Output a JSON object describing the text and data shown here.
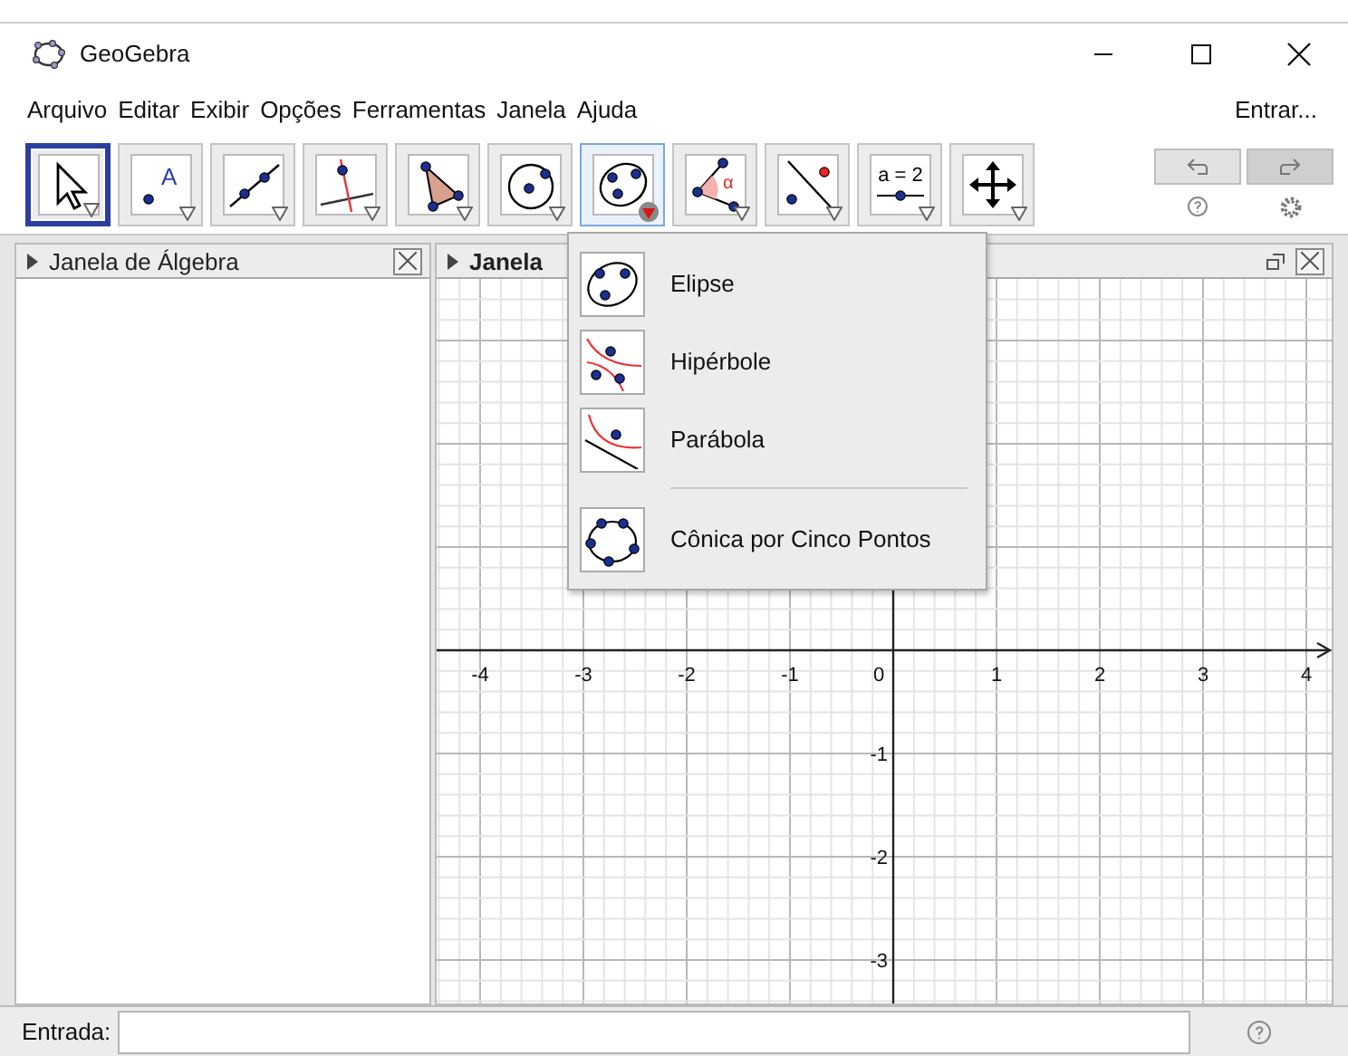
{
  "window": {
    "title": "GeoGebra"
  },
  "menu": [
    "Arquivo",
    "Editar",
    "Exibir",
    "Opções",
    "Ferramentas",
    "Janela",
    "Ajuda"
  ],
  "sign_in": "Entrar...",
  "tools": [
    {
      "kind": "move",
      "selected": true,
      "open": false
    },
    {
      "kind": "point",
      "caption": "A",
      "selected": false,
      "open": false
    },
    {
      "kind": "line",
      "selected": false,
      "open": false
    },
    {
      "kind": "perpendicular",
      "selected": false,
      "open": false
    },
    {
      "kind": "polygon",
      "selected": false,
      "open": false
    },
    {
      "kind": "circle",
      "selected": false,
      "open": false
    },
    {
      "kind": "ellipse",
      "selected": false,
      "open": true
    },
    {
      "kind": "angle",
      "caption": "α",
      "selected": false,
      "open": false
    },
    {
      "kind": "reflect",
      "selected": false,
      "open": false
    },
    {
      "kind": "slider",
      "caption": "a = 2",
      "selected": false,
      "open": false
    },
    {
      "kind": "pan",
      "selected": false,
      "open": false
    }
  ],
  "tool_menu": {
    "groups": [
      [
        {
          "kind": "ellipse",
          "label": "Elipse"
        },
        {
          "kind": "hyperbola",
          "label": "Hipérbole"
        },
        {
          "kind": "parabola",
          "label": "Parábola"
        }
      ],
      [
        {
          "kind": "conic5",
          "label": "Cônica por Cinco Pontos"
        }
      ]
    ]
  },
  "algebra_view": {
    "title": "Janela de Álgebra"
  },
  "graphics_view": {
    "title": "Janela",
    "x_labels": [
      "-4",
      "-3",
      "-2",
      "-1",
      "0",
      "1",
      "2",
      "3",
      "4"
    ],
    "y_labels": [
      "-1",
      "-2",
      "-3"
    ]
  },
  "input_bar": {
    "label": "Entrada:"
  }
}
